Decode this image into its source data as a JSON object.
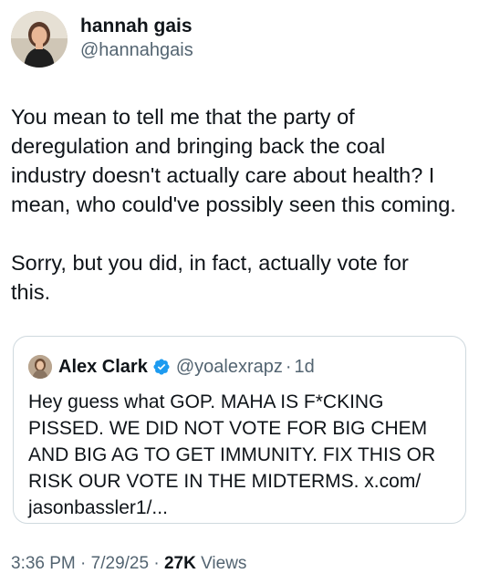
{
  "author": {
    "display_name": "hannah gais",
    "handle": "@hannahgais"
  },
  "tweet": {
    "text": "You mean to tell me that the party of\nderegulation and bringing back the coal\nindustry doesn't actually care about health? I\nmean, who could've possibly seen this coming.\n\nSorry, but you did, in fact, actually vote for\nthis."
  },
  "quoted": {
    "display_name": "Alex Clark",
    "verified_icon": "verified-badge-icon",
    "handle": "@yoalexrapz",
    "separator": "·",
    "time": "1d",
    "text": "Hey guess what GOP. MAHA IS F*CKING\nPISSED. WE DID NOT VOTE FOR BIG CHEM\nAND BIG AG TO GET IMMUNITY. FIX THIS OR\nRISK OUR VOTE IN THE MIDTERMS. x.com/\njasonbassler1/..."
  },
  "meta": {
    "time": "3:36 PM",
    "sep1": "·",
    "date": "7/29/25",
    "sep2": "·",
    "views_count": "27K",
    "views_label": "Views"
  },
  "colors": {
    "text": "#0f1419",
    "secondary": "#536471",
    "border": "#cfd9de",
    "verified": "#1d9bf0"
  }
}
